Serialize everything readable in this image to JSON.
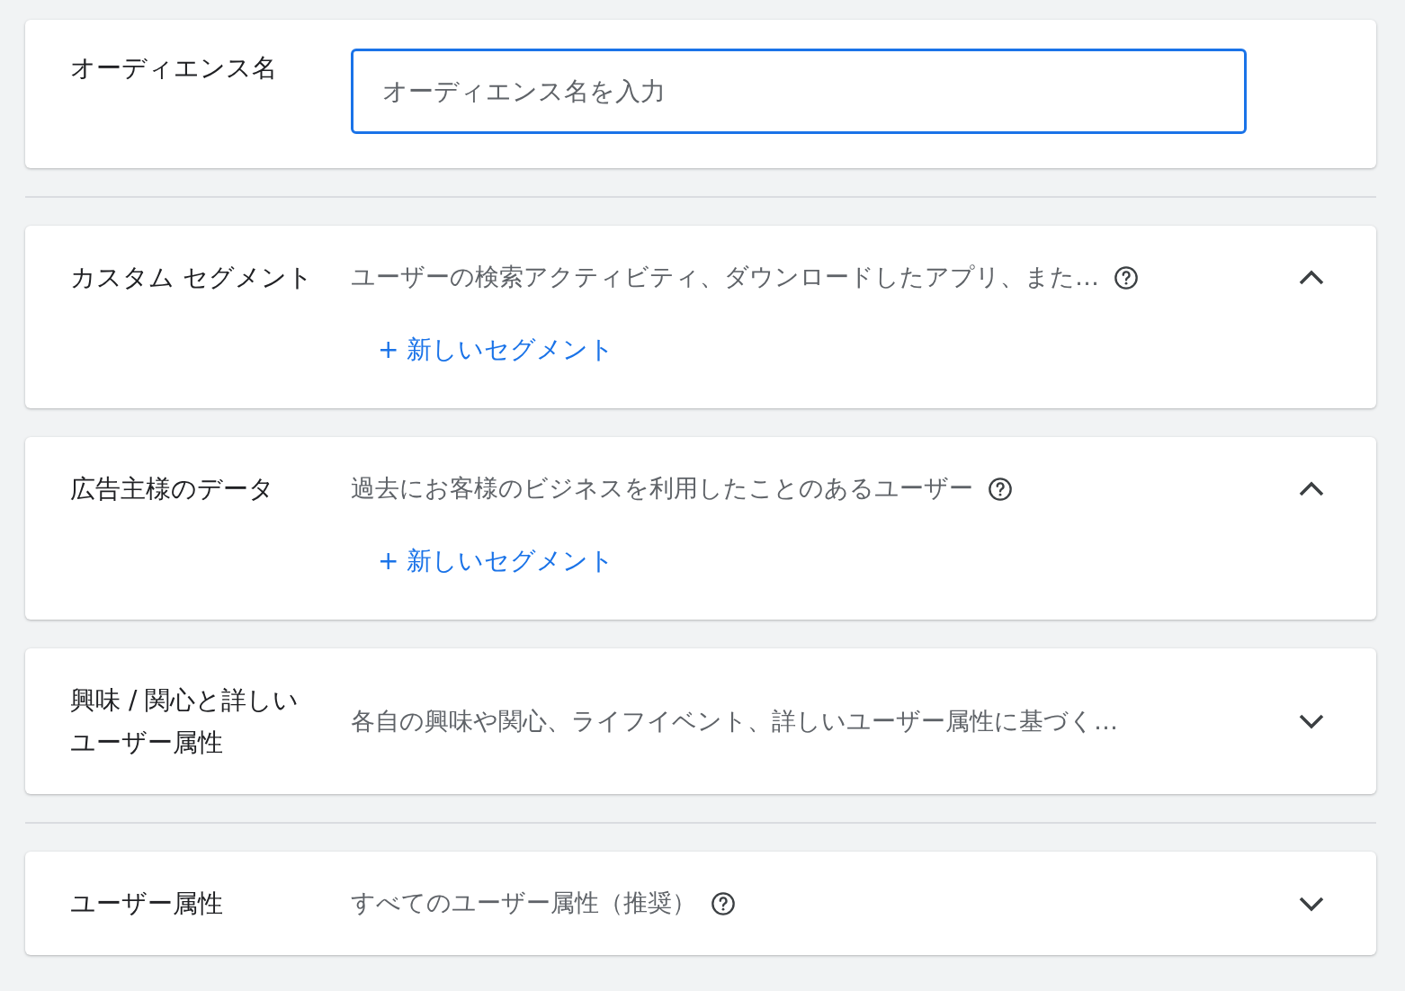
{
  "audience_name": {
    "label": "オーディエンス名",
    "placeholder": "オーディエンス名を入力"
  },
  "groups": [
    {
      "sections": [
        {
          "title": "カスタム セグメント",
          "description": "ユーザーの検索アクティビティ、ダウンロードしたアプリ、また…",
          "help": true,
          "expanded": true,
          "action": "+ 新しいセグメント"
        },
        {
          "title": "広告主様のデータ",
          "description": "過去にお客様のビジネスを利用したことのあるユーザー",
          "help": true,
          "expanded": true,
          "action": "+ 新しいセグメント"
        },
        {
          "title": "興味 / 関心と詳しいユーザー属性",
          "description": "各自の興味や関心、ライフイベント、詳しいユーザー属性に基づく…",
          "help": false,
          "expanded": false
        }
      ]
    },
    {
      "sections": [
        {
          "title": "ユーザー属性",
          "description": "すべてのユーザー属性（推奨）",
          "help": true,
          "expanded": false
        }
      ]
    }
  ]
}
